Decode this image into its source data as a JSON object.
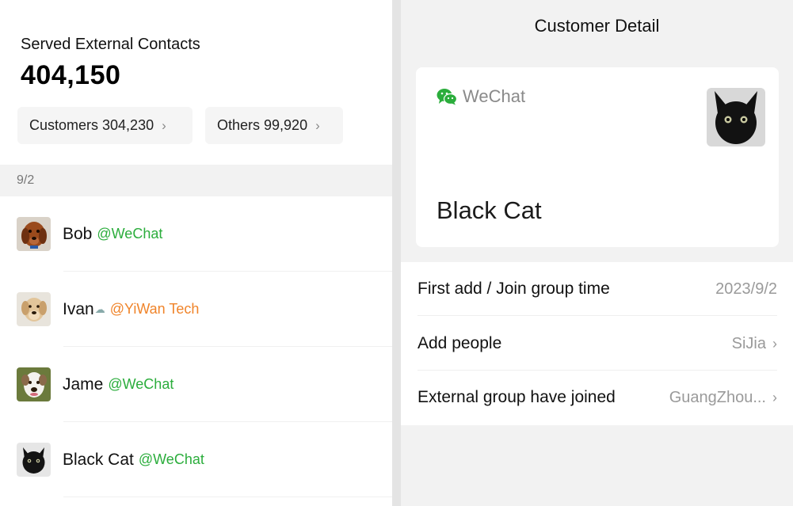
{
  "summary": {
    "title": "Served External Contacts",
    "total": "404,150",
    "customers_label": "Customers 304,230",
    "others_label": "Others 99,920"
  },
  "date_header": "9/2",
  "contacts": [
    {
      "name": "Bob",
      "tag": "@WeChat",
      "tag_color": "#2bad3c"
    },
    {
      "name": "Ivan",
      "tag": "@YiWan Tech",
      "tag_color": "#f0842a"
    },
    {
      "name": "Jame",
      "tag": "@WeChat",
      "tag_color": "#2bad3c"
    },
    {
      "name": "Black Cat",
      "tag": "@WeChat",
      "tag_color": "#2bad3c"
    }
  ],
  "detail": {
    "nav_title": "Customer Detail",
    "source_label": "WeChat",
    "customer_name": "Black Cat",
    "rows": [
      {
        "label": "First add / Join group time",
        "value": "2023/9/2"
      },
      {
        "label": "Add people",
        "value": "SiJia"
      },
      {
        "label": "External group have joined",
        "value": "GuangZhou..."
      }
    ]
  },
  "colors": {
    "wechat_green": "#2bad3c",
    "org_orange": "#f0842a"
  }
}
